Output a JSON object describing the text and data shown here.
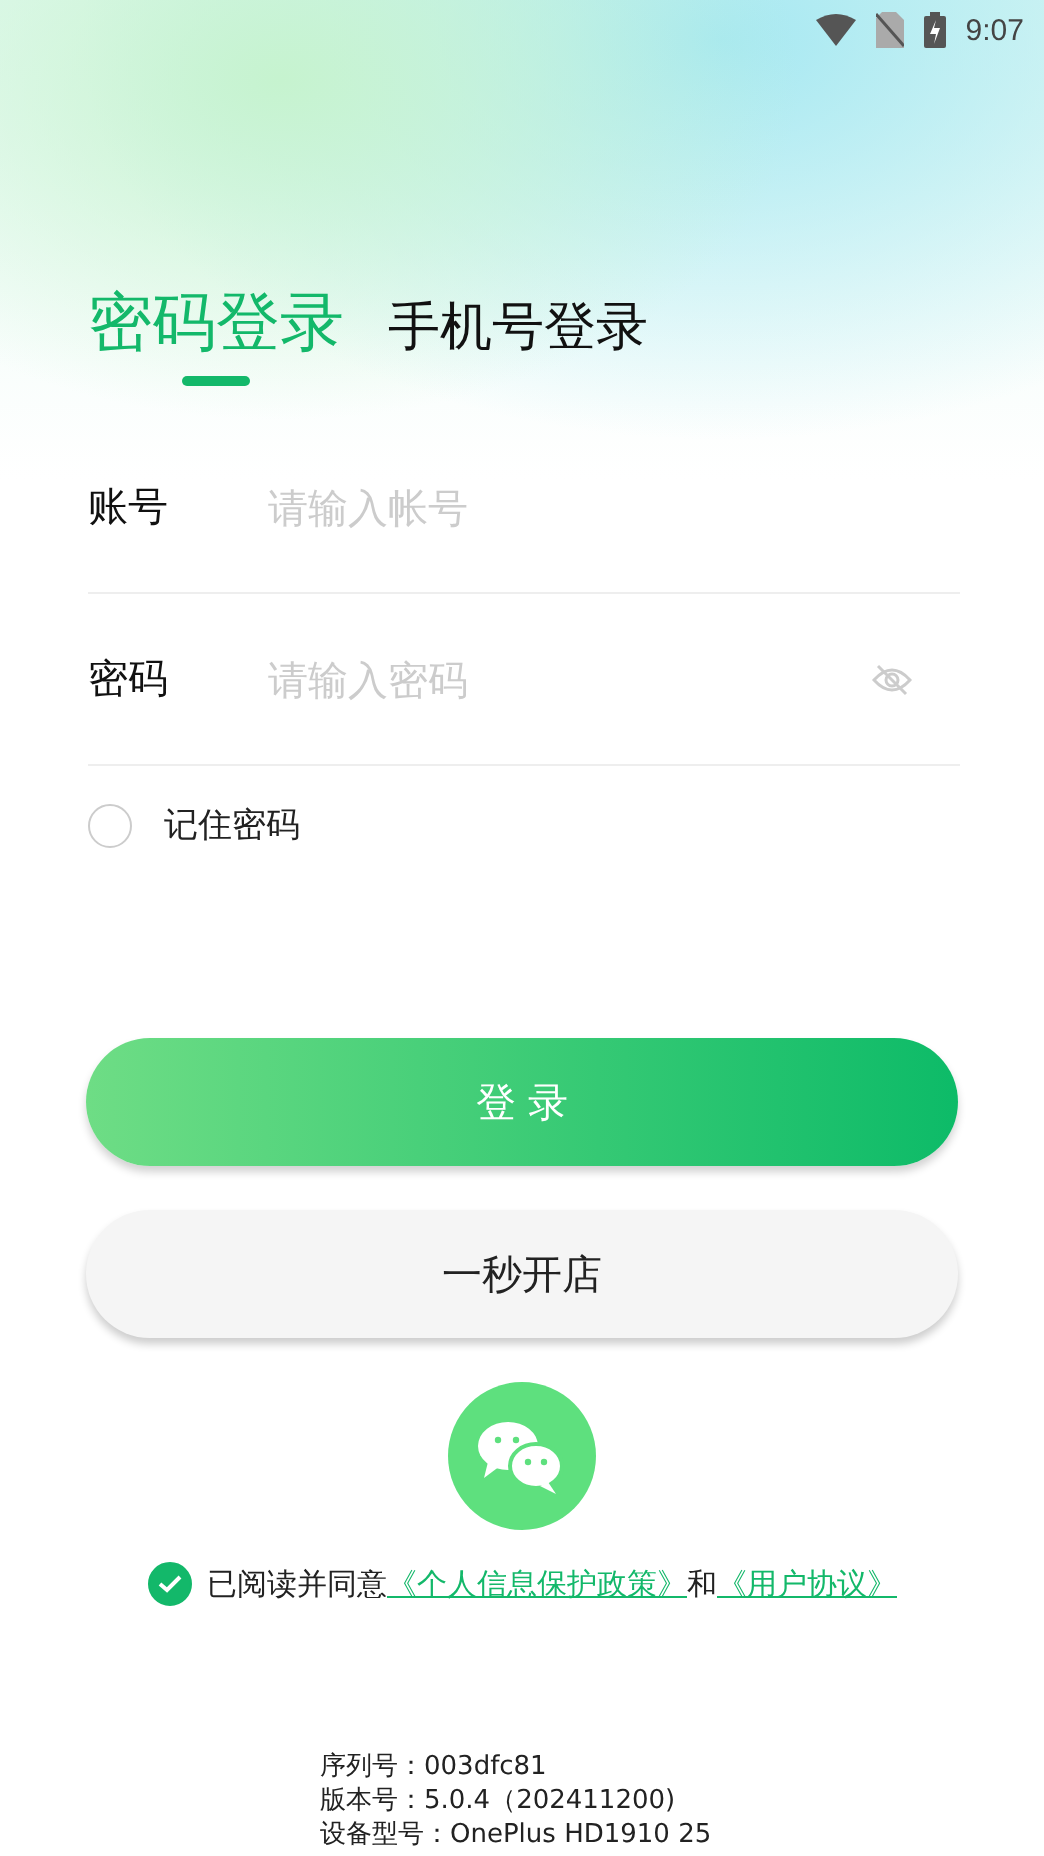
{
  "status_bar": {
    "time": "9:07"
  },
  "tabs": [
    {
      "label": "密码登录",
      "selected": true
    },
    {
      "label": "手机号登录",
      "selected": false
    }
  ],
  "fields": [
    {
      "label": "账号",
      "placeholder": "请输入帐号",
      "kind": "text"
    },
    {
      "label": "密码",
      "placeholder": "请输入密码",
      "kind": "password"
    }
  ],
  "remember": {
    "label": "记住密码",
    "checked": false
  },
  "buttons": [
    {
      "label": "登 录",
      "kind": "primary"
    },
    {
      "label": "一秒开店",
      "kind": "secondary"
    }
  ],
  "agreement": {
    "checked": true,
    "text": "已阅读并同意",
    "links": [
      "《个人信息保护政策》",
      "《用户协议》"
    ],
    "joiner": "和"
  },
  "footer": [
    "序列号：003dfc81",
    "版本号：5.0.4（202411200)",
    "设备型号：OnePlus HD1910 25"
  ]
}
